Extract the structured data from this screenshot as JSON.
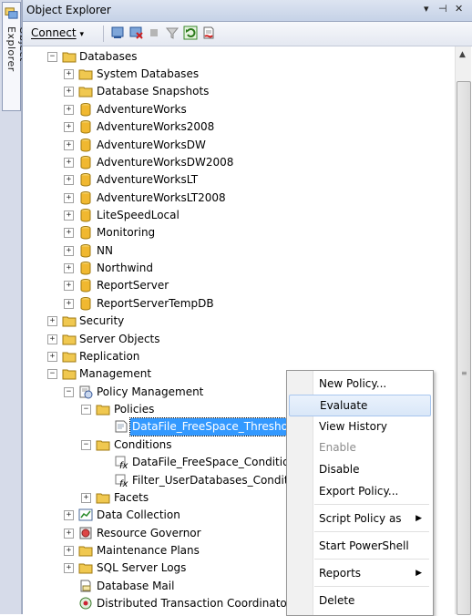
{
  "side_tab": {
    "label": "Object Explorer"
  },
  "panel": {
    "title": "Object Explorer",
    "controls": {
      "dropdown": "▾",
      "pin": "⊣",
      "close": "✕"
    }
  },
  "toolbar": {
    "connect_label": "Connect",
    "connect_arrow": "▾"
  },
  "tree": {
    "databases": "Databases",
    "system_databases": "System Databases",
    "database_snapshots": "Database Snapshots",
    "db_adventureworks": "AdventureWorks",
    "db_adventureworks2008": "AdventureWorks2008",
    "db_adventureworksdw": "AdventureWorksDW",
    "db_adventureworksdw2008": "AdventureWorksDW2008",
    "db_adventureworkslt": "AdventureWorksLT",
    "db_adventureworkslt2008": "AdventureWorksLT2008",
    "db_litespeedlocal": "LiteSpeedLocal",
    "db_monitoring": "Monitoring",
    "db_nn": "NN",
    "db_northwind": "Northwind",
    "db_reportserver": "ReportServer",
    "db_reportservertempdb": "ReportServerTempDB",
    "security": "Security",
    "server_objects": "Server Objects",
    "replication": "Replication",
    "management": "Management",
    "policy_management": "Policy Management",
    "policies": "Policies",
    "selected_policy": "DataFile_FreeSpace_Threshold_P",
    "conditions": "Conditions",
    "condition_1": "DataFile_FreeSpace_Condition",
    "condition_2": "Filter_UserDatabases_Condition",
    "facets": "Facets",
    "data_collection": "Data Collection",
    "resource_governor": "Resource Governor",
    "maintenance_plans": "Maintenance Plans",
    "sql_server_logs": "SQL Server Logs",
    "database_mail": "Database Mail",
    "dtc": "Distributed Transaction Coordinator"
  },
  "context_menu": {
    "new_policy": "New Policy...",
    "evaluate": "Evaluate",
    "view_history": "View History",
    "enable": "Enable",
    "disable": "Disable",
    "export_policy": "Export Policy...",
    "script_policy_as": "Script Policy as",
    "start_powershell": "Start PowerShell",
    "reports": "Reports",
    "delete": "Delete",
    "submenu_arrow": "▶"
  },
  "scrollbar": {
    "up_arrow": "▲",
    "grip": "≡"
  },
  "colors": {
    "selection": "#3399ff",
    "folder": "#f0c850",
    "database": "#f0b830",
    "menu_highlight": "#d9e7f8"
  }
}
